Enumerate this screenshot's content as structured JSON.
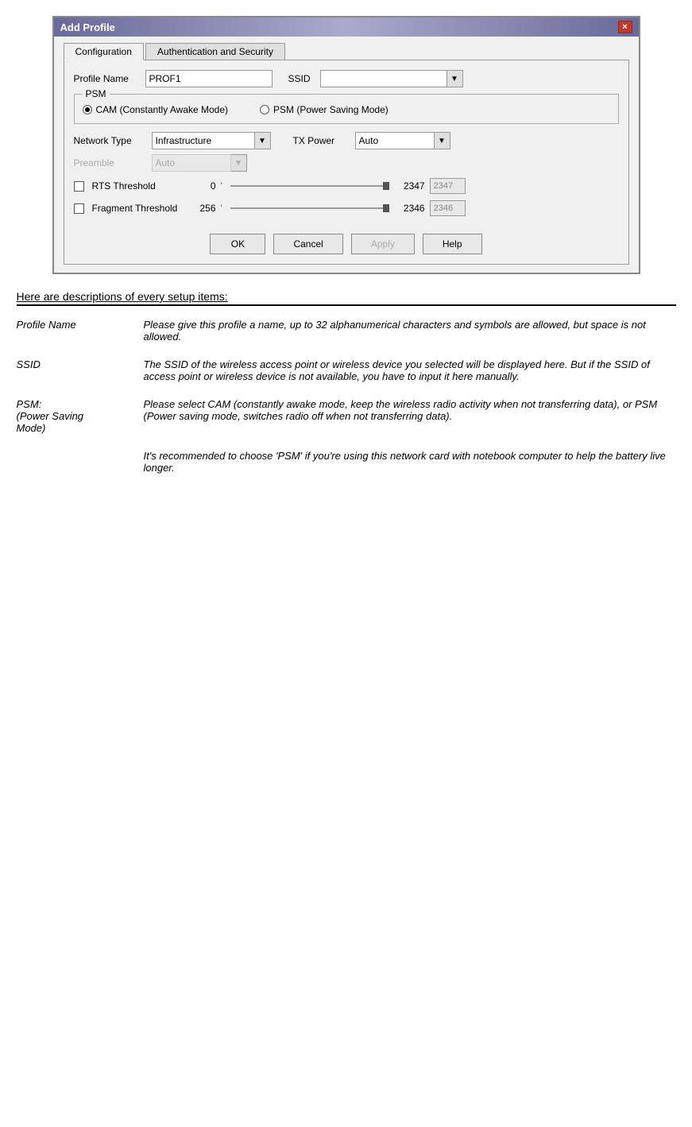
{
  "dialog": {
    "title": "Add Profile",
    "tabs": [
      {
        "label": "Configuration",
        "active": true
      },
      {
        "label": "Authentication and Security",
        "active": false
      }
    ],
    "close_button": "×",
    "fields": {
      "profile_name_label": "Profile Name",
      "profile_name_value": "PROF1",
      "ssid_label": "SSID",
      "ssid_value": ""
    },
    "psm": {
      "legend": "PSM",
      "cam_label": "CAM (Constantly Awake Mode)",
      "psm_label": "PSM (Power Saving Mode)"
    },
    "network": {
      "type_label": "Network Type",
      "type_value": "Infrastructure",
      "tx_power_label": "TX Power",
      "tx_power_value": "Auto",
      "preamble_label": "Preamble",
      "preamble_value": "Auto"
    },
    "rts": {
      "label": "RTS Threshold",
      "min_val": "0",
      "tick": "'",
      "max_val": "2347",
      "input_val": "2347"
    },
    "fragment": {
      "label": "Fragment Threshold",
      "min_val": "256",
      "tick": "'",
      "max_val": "2346",
      "input_val": "2346"
    },
    "buttons": {
      "ok": "OK",
      "cancel": "Cancel",
      "apply": "Apply",
      "help": "Help"
    }
  },
  "doc": {
    "section_header": "Here are descriptions of every setup items:",
    "rows": [
      {
        "term": "Profile Name",
        "desc": "Please give this profile a name, up to 32 alphanumerical characters and symbols are allowed, but space is not allowed."
      },
      {
        "term": "SSID",
        "desc": "The SSID of the wireless access point or wireless device you selected will be displayed here. But if the SSID of access point or wireless device is not available, you have to input it here manually."
      },
      {
        "term": "PSM:\n(Power Saving\nMode)",
        "desc": "Please select CAM (constantly awake mode, keep the wireless radio activity when not transferring data), or PSM (Power saving mode, switches radio off when not transferring data)."
      },
      {
        "term": "",
        "desc": "It's recommended to choose 'PSM' if you're using this network card with notebook computer to help the battery live longer."
      }
    ]
  }
}
